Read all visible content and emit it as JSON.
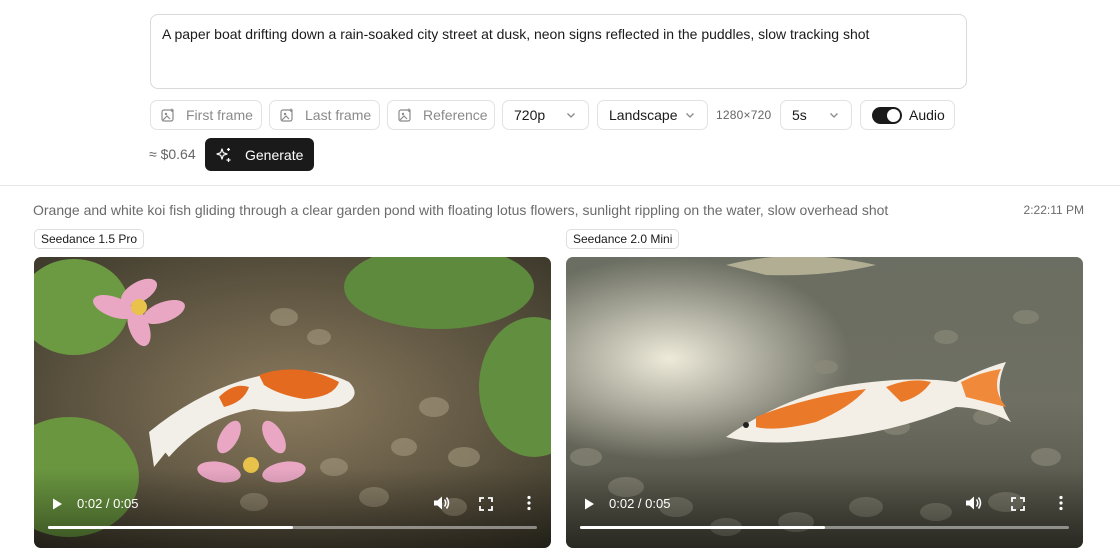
{
  "composer": {
    "prompt": "A paper boat drifting down a rain-soaked city street at dusk, neon signs reflected in the puddles, slow tracking shot",
    "first_frame_label": "First frame",
    "last_frame_label": "Last frame",
    "reference_label": "Reference",
    "resolution": "720p",
    "orientation": "Landscape",
    "dimensions": "1280×720",
    "duration": "5s",
    "audio_label": "Audio",
    "audio_enabled": true,
    "cost": "≈ $0.64",
    "generate_label": "Generate"
  },
  "history": {
    "prompt": "Orange and white koi fish gliding through a clear garden pond with floating lotus flowers, sunlight rippling on the water, slow overhead shot",
    "time": "2:22:11 PM",
    "results": [
      {
        "model": "Seedance 1.5 Pro",
        "time_display": "0:02 / 0:05",
        "progress": 0.5
      },
      {
        "model": "Seedance 2.0 Mini",
        "time_display": "0:02 / 0:05",
        "progress": 0.5
      }
    ]
  }
}
